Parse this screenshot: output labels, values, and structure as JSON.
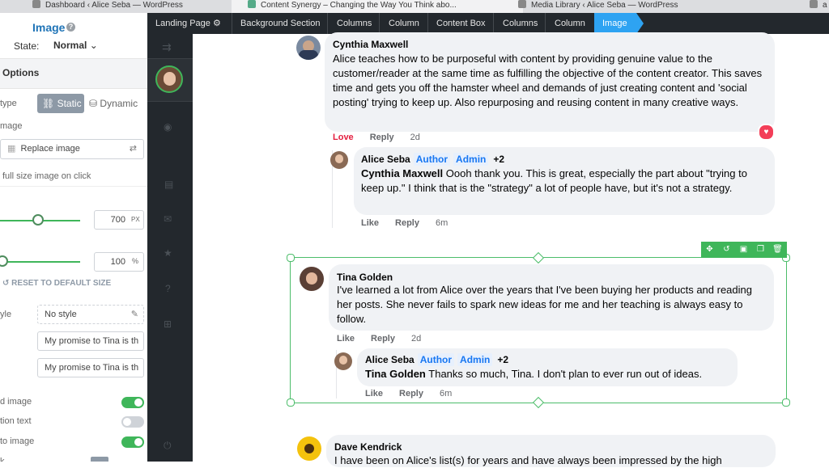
{
  "browser": {
    "tabs": [
      {
        "label": "Dashboard ‹ Alice Seba — WordPress"
      },
      {
        "label": "Content Synergy – Changing the Way You Think abo..."
      },
      {
        "label": "Media Library ‹ Alice Seba — WordPress"
      },
      {
        "label": "a"
      }
    ]
  },
  "panel": {
    "title": "Image",
    "help_icon": "question-circle-icon",
    "state_label": "State:",
    "state_value": "Normal",
    "options_label": "Options",
    "type_label": "type",
    "static_label": "Static",
    "dynamic_label": "Dynamic",
    "image_label": "mage",
    "replace_label": "Replace image",
    "full_size_label": "full size image on click",
    "width_value": "700",
    "width_unit": "PX",
    "percent_value": "100",
    "percent_unit": "%",
    "reset_label": "RESET TO DEFAULT SIZE",
    "style_label": "yle",
    "style_value": "No style",
    "alt_value": "My promise to Tina is th",
    "title_value": "My promise to Tina is th",
    "toggle1_label": "d image",
    "toggle2_label": "tion text",
    "toggle3_label": "to image",
    "toggle4_label": "k",
    "toggle1": true,
    "toggle2": false,
    "toggle3": true
  },
  "breadcrumbs": [
    {
      "label": "Landing Page"
    },
    {
      "label": "Background Section"
    },
    {
      "label": "Columns"
    },
    {
      "label": "Column"
    },
    {
      "label": "Content Box"
    },
    {
      "label": "Columns"
    },
    {
      "label": "Column"
    },
    {
      "label": "Image"
    }
  ],
  "comments": {
    "c1": {
      "name": "Cynthia Maxwell",
      "text": "Alice teaches how to be purposeful with content by providing genuine value to the customer/reader at the same time as fulfilling the objective of the content creator. This saves time and gets you off the hamster wheel and demands of just creating content and 'social posting' trying to keep up. Also repurposing and reusing content in many creative ways.",
      "love": "Love",
      "reply": "Reply",
      "time": "2d"
    },
    "r1": {
      "name": "Alice Seba",
      "author": "Author",
      "admin": "Admin",
      "plus": "+2",
      "mention": "Cynthia Maxwell",
      "text": " Oooh thank you. This is great, especially the part about \"trying to keep up.\" I think that is the \"strategy\" a lot of people have, but it's not a strategy.",
      "like": "Like",
      "reply": "Reply",
      "time": "6m"
    },
    "c2": {
      "name": "Tina Golden",
      "text": "I've learned a lot from Alice over the years that I've been buying her products and reading her posts. She never fails to spark new ideas for me and her teaching is always easy to follow.",
      "like": "Like",
      "reply": "Reply",
      "time": "2d"
    },
    "r2": {
      "name": "Alice Seba",
      "author": "Author",
      "admin": "Admin",
      "plus": "+2",
      "mention": "Tina Golden",
      "text": " Thanks so much, Tina. I don't plan to ever run out of ideas.",
      "like": "Like",
      "reply": "Reply",
      "time": "6m"
    },
    "c3": {
      "name": "Dave Kendrick",
      "text": "I have been on Alice's list(s) for years and have always been impressed by the high"
    }
  },
  "colors": {
    "accent_blue": "#2ea3f2",
    "select_green": "#3fb65a",
    "fb_bubble": "#f0f2f5",
    "link_blue": "#1877f2",
    "love_red": "#e41e3f"
  }
}
